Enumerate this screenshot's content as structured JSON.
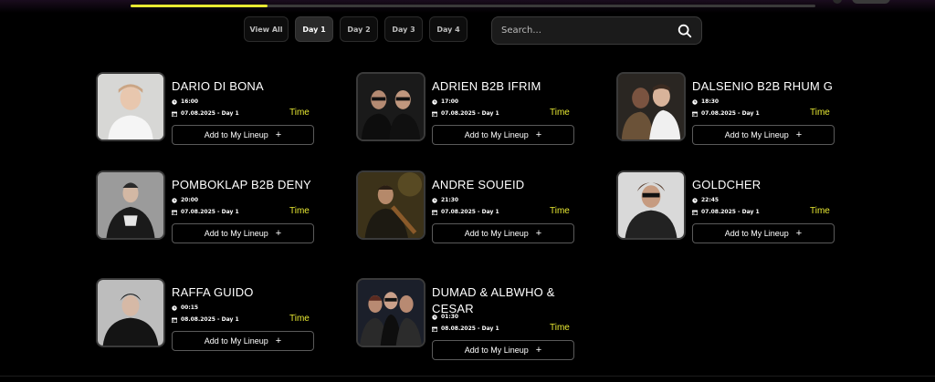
{
  "progress": {
    "fraction": 0.2,
    "color": "#e7e832"
  },
  "tabs": [
    {
      "label": "View All",
      "active": false
    },
    {
      "label": "Day 1",
      "active": true
    },
    {
      "label": "Day 2",
      "active": false
    },
    {
      "label": "Day 3",
      "active": false
    },
    {
      "label": "Day 4",
      "active": false
    }
  ],
  "search": {
    "placeholder": "Search...",
    "icon": "search-icon"
  },
  "button_label": "Add to My Lineup",
  "button_icon": "plus-icon",
  "time_label": "Time",
  "artists": [
    {
      "name": "DARIO DI BONA",
      "time": "16:00",
      "date": "07.08.2025 - Day 1"
    },
    {
      "name": "ADRIEN B2B IFRIM",
      "time": "17:00",
      "date": "07.08.2025 - Day 1"
    },
    {
      "name": "DALSENIO B2B RHUM G",
      "time": "18:30",
      "date": "07.08.2025 - Day 1"
    },
    {
      "name": "POMBOKLAP B2B DENY",
      "time": "20:00",
      "date": "07.08.2025 - Day 1"
    },
    {
      "name": "ANDRE SOUEID",
      "time": "21:30",
      "date": "07.08.2025 - Day 1"
    },
    {
      "name": "GOLDCHER",
      "time": "22:45",
      "date": "07.08.2025 - Day 1"
    },
    {
      "name": "RAFFA GUIDO",
      "time": "00:15",
      "date": "08.08.2025 - Day 1"
    },
    {
      "name": "DUMAD & ALBWHO & CESAR",
      "time": "01:30",
      "date": "08.08.2025 - Day 1"
    }
  ]
}
